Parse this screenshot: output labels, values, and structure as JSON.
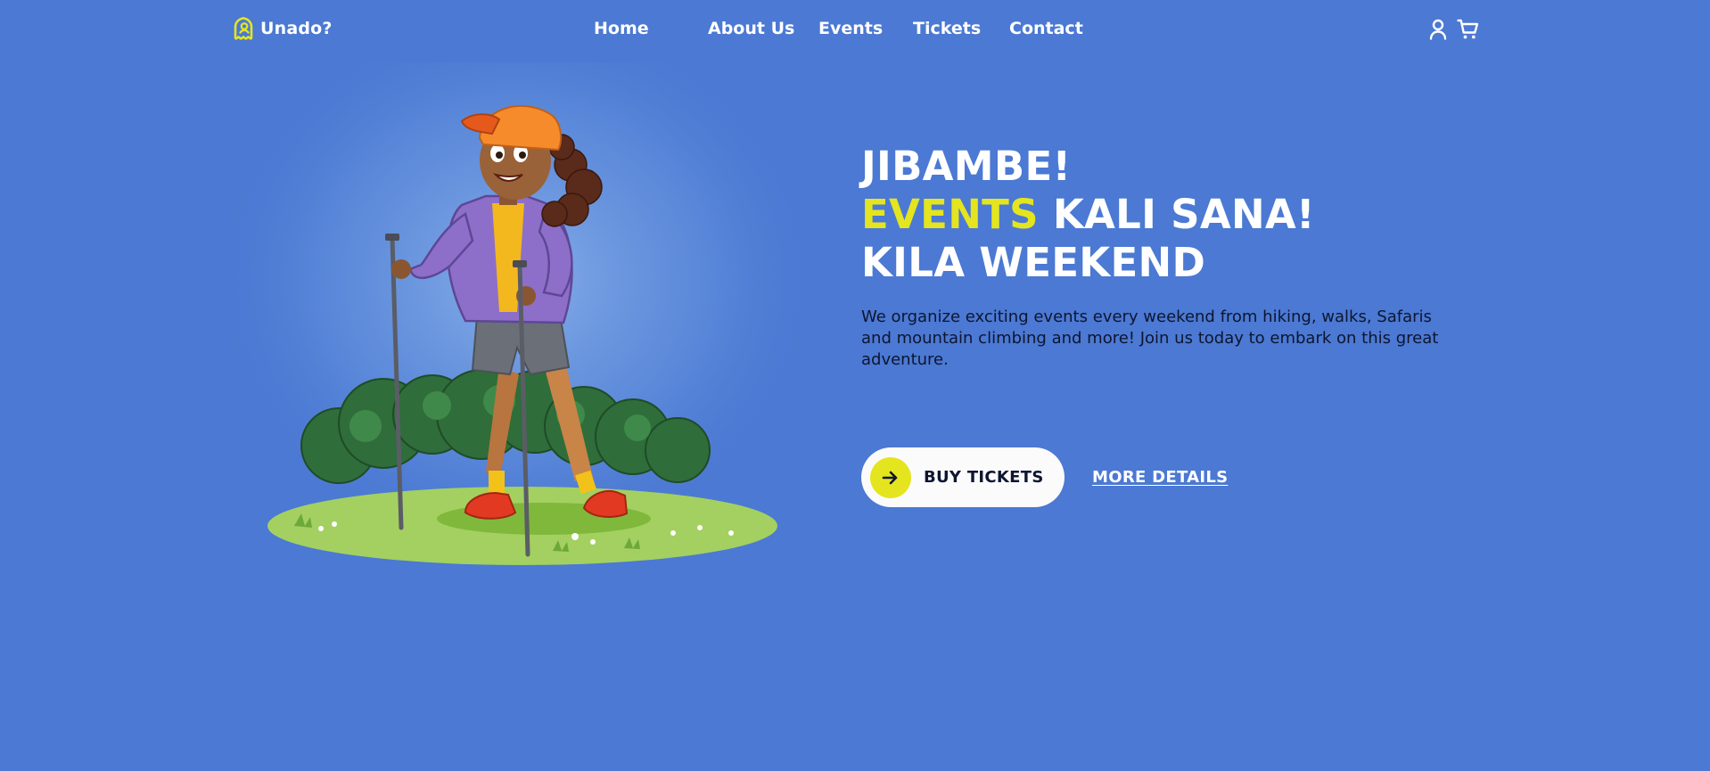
{
  "brand": {
    "name": "Unado?",
    "logo_icon": "ghost-pin-icon",
    "accent_color": "#e4e51e"
  },
  "nav": {
    "items": [
      {
        "label": "Home"
      },
      {
        "label": "About Us"
      },
      {
        "label": "Events"
      },
      {
        "label": "Tickets"
      },
      {
        "label": "Contact"
      }
    ],
    "actions": [
      {
        "icon": "user-icon"
      },
      {
        "icon": "cart-icon"
      }
    ]
  },
  "hero": {
    "headline": {
      "line1": "JIBAMBE!",
      "line2_accent": "EVENTS",
      "line2_rest": " KALI SANA!",
      "line3": "KILA WEEKEND"
    },
    "description": "We organize exciting events every weekend from hiking, walks, Safaris and mountain climbing and more! Join us today to embark on this great adventure.",
    "primary_cta": {
      "label": "BUY TICKETS",
      "icon": "arrow-right-icon"
    },
    "secondary_cta": {
      "label": "MORE DETAILS"
    },
    "illustration": "hiker-girl-illustration"
  },
  "colors": {
    "background": "#4b79d3",
    "accent": "#e4e51e",
    "text_dark": "#0e1530",
    "button_bg": "#fbfbfc"
  }
}
